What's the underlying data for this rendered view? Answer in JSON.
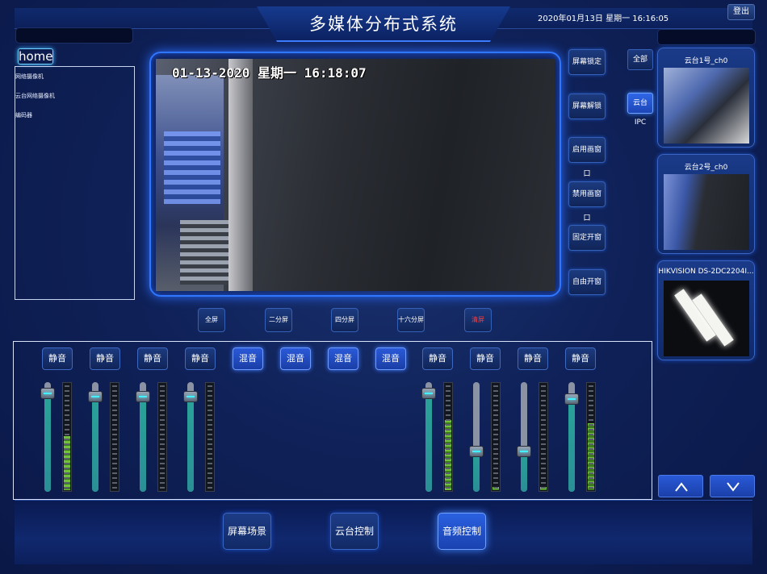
{
  "header": {
    "title": "多媒体分布式系统",
    "datetime": "2020年01月13日 星期一 16:16:05",
    "logout_label": "登出"
  },
  "tree": {
    "home_label": "home",
    "items": [
      "网络摄像机",
      "云台网络摄像机",
      "编码器"
    ]
  },
  "video": {
    "osd_text": "01-13-2020 星期一 16:18:07"
  },
  "side_actions": [
    "屏幕锁定",
    "屏幕解锁",
    "启用画窗口",
    "禁用画窗口",
    "固定开窗",
    "自由开窗"
  ],
  "filters": {
    "all_label": "全部",
    "ptz_label": "云台IPC",
    "active": "云台IPC"
  },
  "cameras": [
    {
      "title": "云台1号_ch0"
    },
    {
      "title": "云台2号_ch0"
    },
    {
      "title": "HIKVISION DS-2DC2204I..."
    }
  ],
  "split_modes": [
    "全屏",
    "二分屏",
    "四分屏",
    "十六分屏",
    "清屏"
  ],
  "mixer": {
    "channels": [
      {
        "button": "静音",
        "level": 0.95,
        "meter": 0.5
      },
      {
        "button": "静音",
        "level": 0.92,
        "meter": 0.0
      },
      {
        "button": "静音",
        "level": 0.92,
        "meter": 0.0
      },
      {
        "button": "静音",
        "level": 0.92,
        "meter": 0.0
      },
      {
        "button": "混音"
      },
      {
        "button": "混音"
      },
      {
        "button": "混音"
      },
      {
        "button": "混音"
      },
      {
        "button": "静音",
        "level": 0.95,
        "meter": 0.65
      },
      {
        "button": "静音",
        "level": 0.42,
        "meter": 0.03
      },
      {
        "button": "静音",
        "level": 0.42,
        "meter": 0.03
      },
      {
        "button": "静音",
        "level": 0.9,
        "meter": 0.62
      }
    ]
  },
  "nav": {
    "items": [
      "屏幕场景",
      "云台控制",
      "音频控制"
    ],
    "active": "音频控制"
  },
  "colors": {
    "accent": "#2f77ff",
    "clear_text": "#ff3b3b",
    "background": "#0f2158"
  },
  "icons": {
    "up": "chevron-up-icon",
    "down": "chevron-down-icon"
  }
}
